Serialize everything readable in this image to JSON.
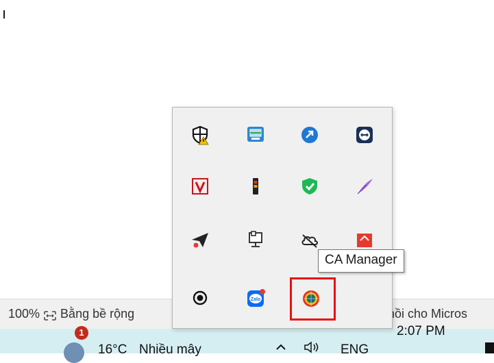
{
  "status_bar": {
    "zoom": "100%",
    "fit_label": "Bằng bề rộng",
    "right_text": "hồi cho Micros"
  },
  "taskbar": {
    "notification_count": "1",
    "temperature": "16°C",
    "weather": "Nhiều mây",
    "language": "ENG",
    "time": "2:07 PM"
  },
  "tooltip": {
    "text": "CA Manager"
  },
  "tray": {
    "icons": [
      "windows-security-warning-icon",
      "remote-desktop-manager-icon",
      "blue-square-app-icon",
      "teamviewer-icon",
      "v-logo-app-icon",
      "usb-device-icon",
      "green-shield-antivirus-icon",
      "purple-feather-icon",
      "telegram-send-icon",
      "network-monitor-icon",
      "cloud-offline-icon",
      "red-app-icon",
      "record-circle-icon",
      "zalo-icon",
      "ca-manager-icon"
    ]
  }
}
